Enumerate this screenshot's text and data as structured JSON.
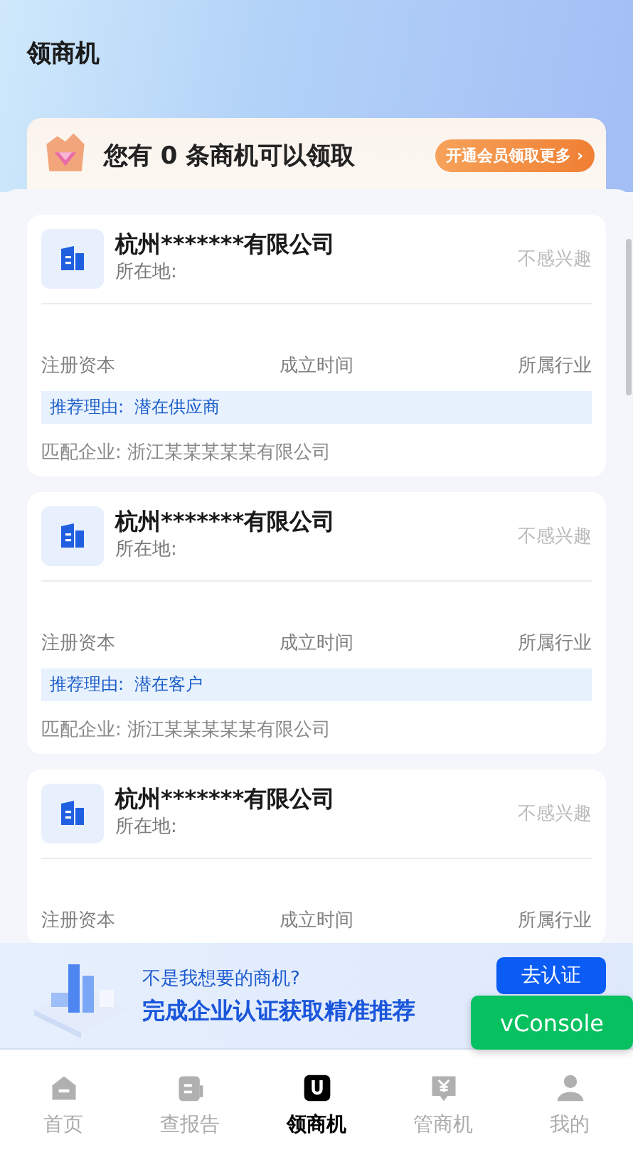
{
  "header": {
    "title": "领商机"
  },
  "banner": {
    "text": "您有 0 条商机可以领取",
    "button": "开通会员领取更多",
    "chevron": "›"
  },
  "cards": [
    {
      "name": "杭州*******有限公司",
      "location": "所在地:",
      "dismiss": "不感兴趣",
      "fields": [
        "注册资本",
        "成立时间",
        "所属行业"
      ],
      "reason_label": "推荐理由:",
      "reason": "潜在供应商",
      "match": "匹配企业: 浙江某某某某某有限公司"
    },
    {
      "name": "杭州*******有限公司",
      "location": "所在地:",
      "dismiss": "不感兴趣",
      "fields": [
        "注册资本",
        "成立时间",
        "所属行业"
      ],
      "reason_label": "推荐理由:",
      "reason": "潜在客户",
      "match": "匹配企业: 浙江某某某某某有限公司"
    },
    {
      "name": "杭州*******有限公司",
      "location": "所在地:",
      "dismiss": "不感兴趣",
      "fields": [
        "注册资本",
        "成立时间",
        "所属行业"
      ]
    }
  ],
  "promo": {
    "question": "不是我想要的商机?",
    "headline": "完成企业认证获取精准推荐",
    "button": "去认证"
  },
  "vconsole": "vConsole",
  "tabs": [
    {
      "kind": "home",
      "label": "首页",
      "selected": false
    },
    {
      "kind": "report",
      "label": "查报告",
      "selected": false
    },
    {
      "kind": "leads",
      "label": "领商机",
      "selected": true
    },
    {
      "kind": "manage",
      "label": "管商机",
      "selected": false
    },
    {
      "kind": "profile",
      "label": "我的",
      "selected": false
    }
  ]
}
